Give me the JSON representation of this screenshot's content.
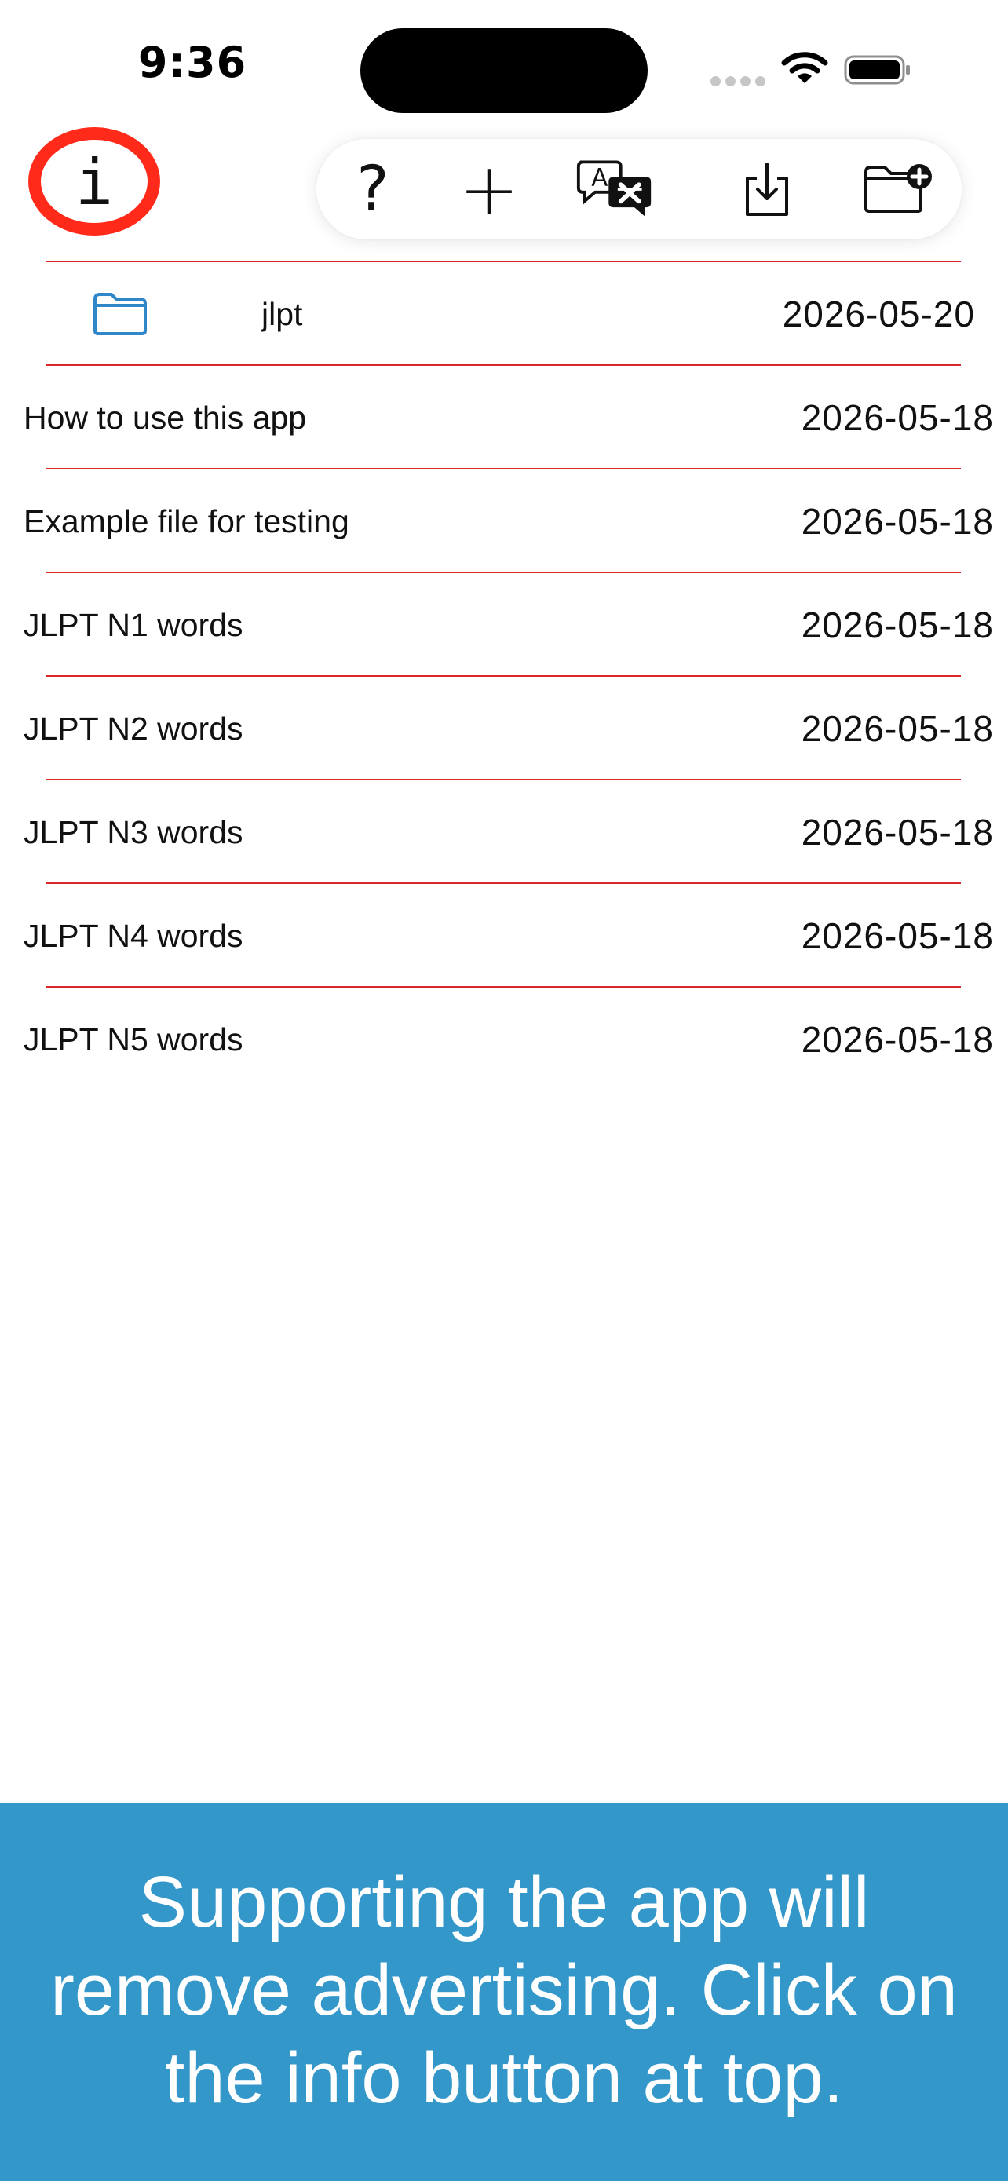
{
  "status_bar": {
    "time": "9:36",
    "wifi_icon": "wifi-icon",
    "battery_icon": "battery-full-icon",
    "cellular_icon": "cellular-no-signal-icon"
  },
  "toolbar": {
    "info_icon": "info-icon",
    "info_glyph": "i",
    "help_icon": "question-mark-icon",
    "help_glyph": "?",
    "add_icon": "plus-icon",
    "add_glyph": "+",
    "translate_icon": "translate-icon",
    "import_icon": "tray-download-icon",
    "new_folder_icon": "folder-badge-plus-icon"
  },
  "colors": {
    "accent_red": "#d9262b",
    "highlight_ring": "#ff2a1a",
    "folder_blue": "#2f86c8",
    "banner_blue": "#3497c9"
  },
  "folders": [
    {
      "name": "jlpt",
      "date": "2026-05-20",
      "icon": "folder-icon"
    }
  ],
  "files": [
    {
      "name": "How to use this app",
      "date": "2026-05-18"
    },
    {
      "name": "Example file for testing",
      "date": "2026-05-18"
    },
    {
      "name": "JLPT N1 words",
      "date": "2026-05-18"
    },
    {
      "name": "JLPT N2 words",
      "date": "2026-05-18"
    },
    {
      "name": "JLPT N3 words",
      "date": "2026-05-18"
    },
    {
      "name": "JLPT N4 words",
      "date": "2026-05-18"
    },
    {
      "name": "JLPT N5 words",
      "date": "2026-05-18"
    }
  ],
  "ad_banner": {
    "text": "Supporting the app will remove advertising.  Click on the info button at top."
  }
}
